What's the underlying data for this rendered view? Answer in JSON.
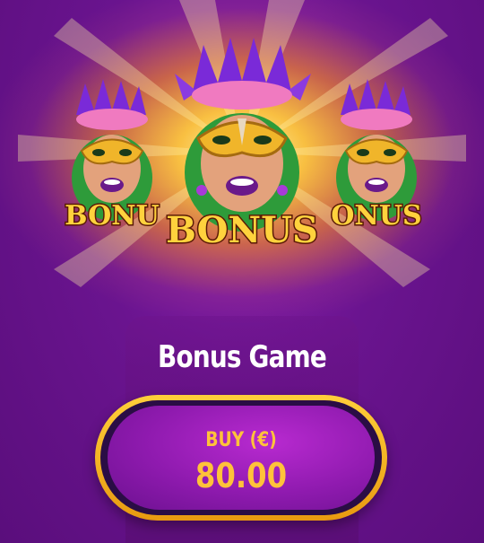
{
  "symbols": [
    {
      "id": "left",
      "label": "BONU"
    },
    {
      "id": "center",
      "label": "BONUS"
    },
    {
      "id": "right",
      "label": "ONUS"
    }
  ],
  "panel": {
    "title": "Bonus Game",
    "buy_label": "BUY (€)",
    "price": "80.00"
  },
  "colors": {
    "background": "#6a148f",
    "accent_gold": "#ffc23a",
    "button_fill": "#9b1fbd",
    "button_border": "#f0a820"
  },
  "icons": [
    "mardi-gras-mask-icon"
  ]
}
